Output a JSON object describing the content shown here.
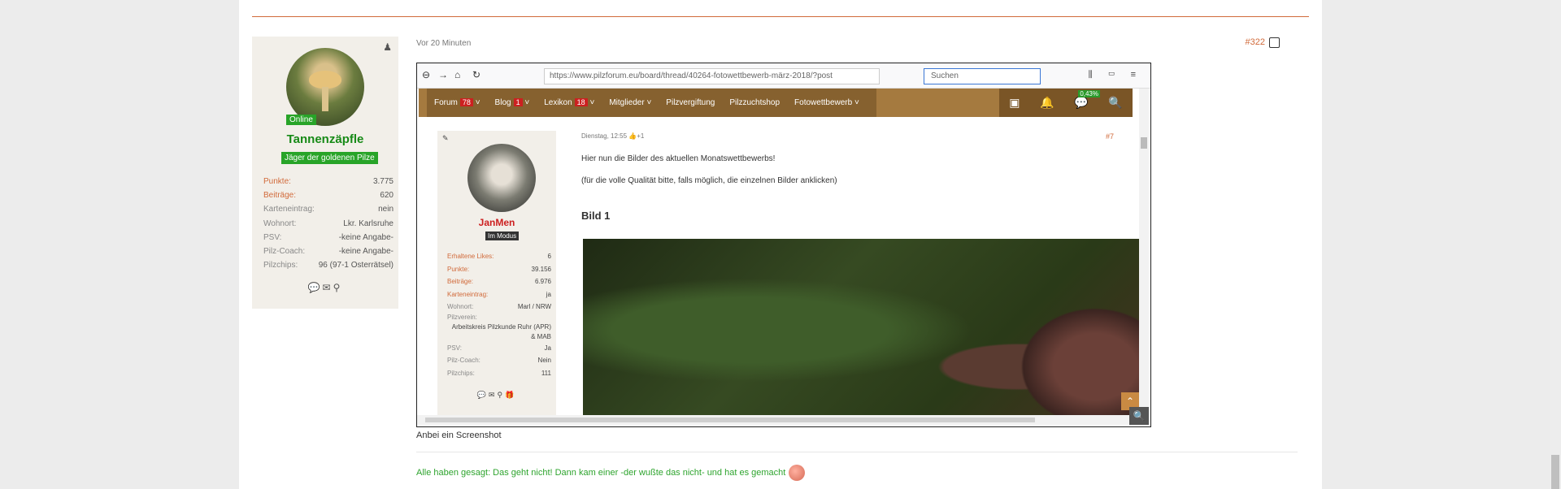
{
  "post": {
    "time": "Vor 20 Minuten",
    "number": "#322",
    "caption": "Anbei ein Screenshot",
    "signature": "Alle haben gesagt: Das geht nicht! Dann kam einer -der wußte das nicht- und hat es gemacht"
  },
  "author": {
    "online": "Online",
    "name": "Tannenzäpfle",
    "rank": "Jäger der goldenen Pilze",
    "stats": [
      {
        "key": "Punkte:",
        "value": "3.775"
      },
      {
        "key": "Beiträge:",
        "value": "620"
      },
      {
        "key": "Karteneintrag:",
        "value": "nein"
      },
      {
        "key": "Wohnort:",
        "value": "Lkr. Karlsruhe"
      },
      {
        "key": "PSV:",
        "value": "-keine Angabe-"
      },
      {
        "key": "Pilz-Coach:",
        "value": "-keine Angabe-"
      },
      {
        "key": "Pilzchips:",
        "value": "96 (97-1 Osterrätsel)"
      }
    ]
  },
  "screenshot": {
    "url": "https://www.pilzforum.eu/board/thread/40264-fotowettbewerb-märz-2018/?post",
    "search_placeholder": "Suchen",
    "nav": [
      {
        "label": "Forum",
        "count": "78"
      },
      {
        "label": "Blog",
        "count": "1"
      },
      {
        "label": "Lexikon",
        "count": "18"
      },
      {
        "label": "Mitglieder",
        "count": ""
      },
      {
        "label": "Pilzvergiftung",
        "count": ""
      },
      {
        "label": "Pilzzuchtshop",
        "count": ""
      },
      {
        "label": "Fotowettbewerb",
        "count": ""
      }
    ],
    "percent": "0,43%",
    "inner_author": {
      "name": "JanMen",
      "rank": "Im Modus",
      "stats": [
        {
          "key": "Erhaltene Likes:",
          "value": "6"
        },
        {
          "key": "Punkte:",
          "value": "39.156"
        },
        {
          "key": "Beiträge:",
          "value": "6.976"
        },
        {
          "key": "Karteneintrag:",
          "value": "ja"
        },
        {
          "key": "Wohnort:",
          "value": "Marl / NRW"
        },
        {
          "key": "Pilzverein:",
          "value": "Arbeitskreis Pilzkunde Ruhr (APR) & MAB"
        },
        {
          "key": "PSV:",
          "value": "Ja"
        },
        {
          "key": "Pilz-Coach:",
          "value": "Nein"
        },
        {
          "key": "Pilzchips:",
          "value": "111"
        }
      ]
    },
    "inner_post": {
      "time": "Dienstag, 12:55",
      "likes": "+1",
      "number": "#7",
      "text1": "Hier nun die Bilder des aktuellen Monatswettbewerbs!",
      "text2": "(für die volle Qualität bitte, falls möglich, die einzelnen Bilder anklicken)",
      "heading": "Bild 1"
    }
  }
}
